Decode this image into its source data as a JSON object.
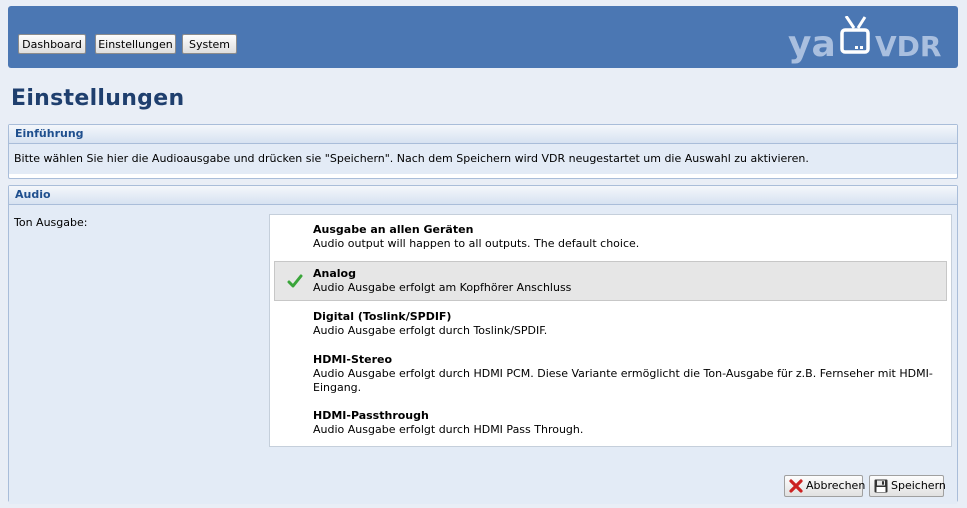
{
  "nav": {
    "dashboard": "Dashboard",
    "einstellungen": "Einstellungen",
    "system": "System"
  },
  "logo": {
    "ya": "ya",
    "vdr": "VDR"
  },
  "page": {
    "title": "Einstellungen"
  },
  "intro": {
    "heading": "Einführung",
    "text": "Bitte wählen Sie hier die Audioausgabe und drücken sie \"Speichern\". Nach dem Speichern wird VDR neugestartet um die Auswahl zu aktivieren."
  },
  "audio": {
    "heading": "Audio",
    "label": "Ton Ausgabe:",
    "selected": "Analog",
    "options": [
      {
        "title": "Ausgabe an allen Geräten",
        "desc": "Audio output will happen to all outputs. The default choice."
      },
      {
        "title": "Analog",
        "desc": "Audio Ausgabe erfolgt am Kopfhörer Anschluss"
      },
      {
        "title": "Digital (Toslink/SPDIF)",
        "desc": "Audio Ausgabe erfolgt durch Toslink/SPDIF."
      },
      {
        "title": "HDMI-Stereo",
        "desc": "Audio Ausgabe erfolgt durch HDMI PCM. Diese Variante ermöglicht die Ton-Ausgabe für z.B. Fernseher mit HDMI-Eingang."
      },
      {
        "title": "HDMI-Passthrough",
        "desc": "Audio Ausgabe erfolgt durch HDMI Pass Through."
      }
    ]
  },
  "actions": {
    "cancel": "Abbrechen",
    "save": "Speichern"
  },
  "colors": {
    "header": "#4b77b3",
    "title": "#1f3f6e",
    "check": "#3aa53a",
    "cancel_icon": "#cc2222"
  }
}
